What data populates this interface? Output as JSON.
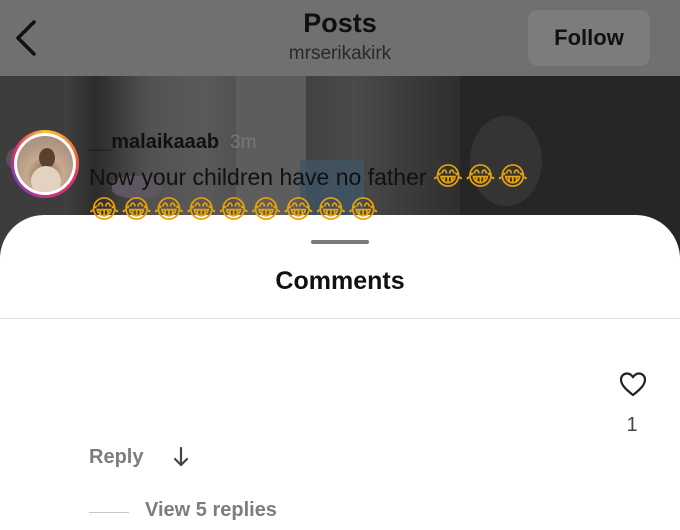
{
  "header": {
    "title": "Posts",
    "subtitle": "mrserikakirk",
    "follow_label": "Follow",
    "back_icon": "chevron-left-icon"
  },
  "sheet": {
    "title": "Comments"
  },
  "comment": {
    "username": "__malaikaaab",
    "time": "3m",
    "text": "Now your children have no father",
    "emojis_line1": "😂😂😂",
    "emojis_line2": "😂😂😂😂😂😂😂😂😂",
    "like_count": "1",
    "reply_label": "Reply",
    "view_replies_label": "View 5 replies"
  },
  "icons": {
    "like": "heart-outline-icon",
    "reply_arrow": "arrow-down-icon"
  },
  "colors": {
    "header_bg": "#707070",
    "sheet_bg": "#ffffff",
    "muted_text": "#7d7d7d"
  }
}
